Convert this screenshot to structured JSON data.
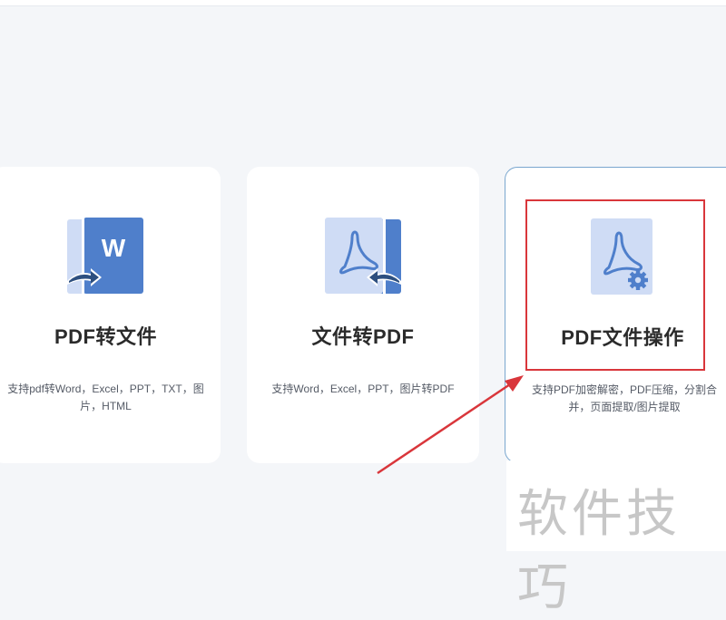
{
  "cards": [
    {
      "title": "PDF转文件",
      "description": "支持pdf转Word，Excel，PPT，TXT，图片，HTML",
      "icon": "pdf-to-word-icon"
    },
    {
      "title": "文件转PDF",
      "description": "支持Word，Excel，PPT，图片转PDF",
      "icon": "file-to-pdf-icon"
    },
    {
      "title": "PDF文件操作",
      "description": "支持PDF加密解密，PDF压缩，分割合并，页面提取/图片提取",
      "icon": "pdf-settings-icon"
    }
  ],
  "watermark": {
    "text": "软件技巧"
  },
  "colors": {
    "accent_blue": "#4f7fcb",
    "light_blue": "#cfdcf5",
    "highlight_red": "#d9363b",
    "card_border": "#7aa7cf"
  }
}
